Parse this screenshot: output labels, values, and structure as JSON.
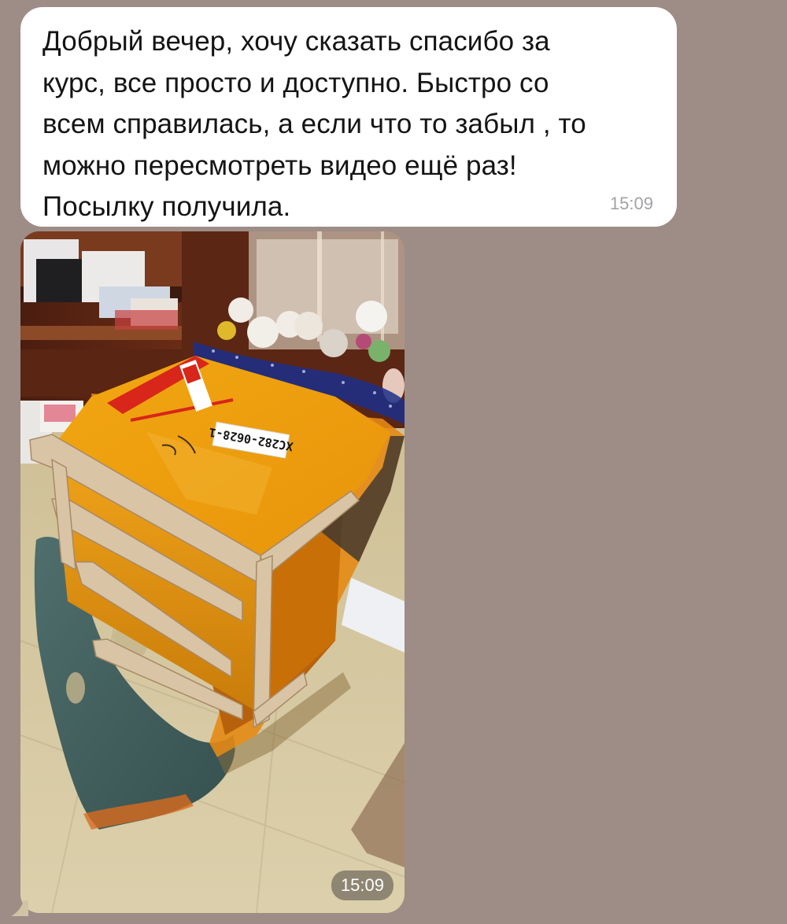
{
  "messages": [
    {
      "type": "text",
      "text": "Добрый вечер, хочу сказать спасибо за\nкурс, все просто и доступно. Быстро со\nвсем справилась, а если что то забыл , то\nможно пересмотреть видео ещё раз!\nПосылку получила.",
      "time": "15:09"
    },
    {
      "type": "photo",
      "image": "wooden-crate-parcel-photo",
      "label_text": "XC282-0628-1",
      "time": "15:09"
    }
  ],
  "colors": {
    "chat_background": "#9e8c87",
    "bubble": "#ffffff",
    "text": "#141414",
    "timestamp": "#a2a2a6"
  }
}
